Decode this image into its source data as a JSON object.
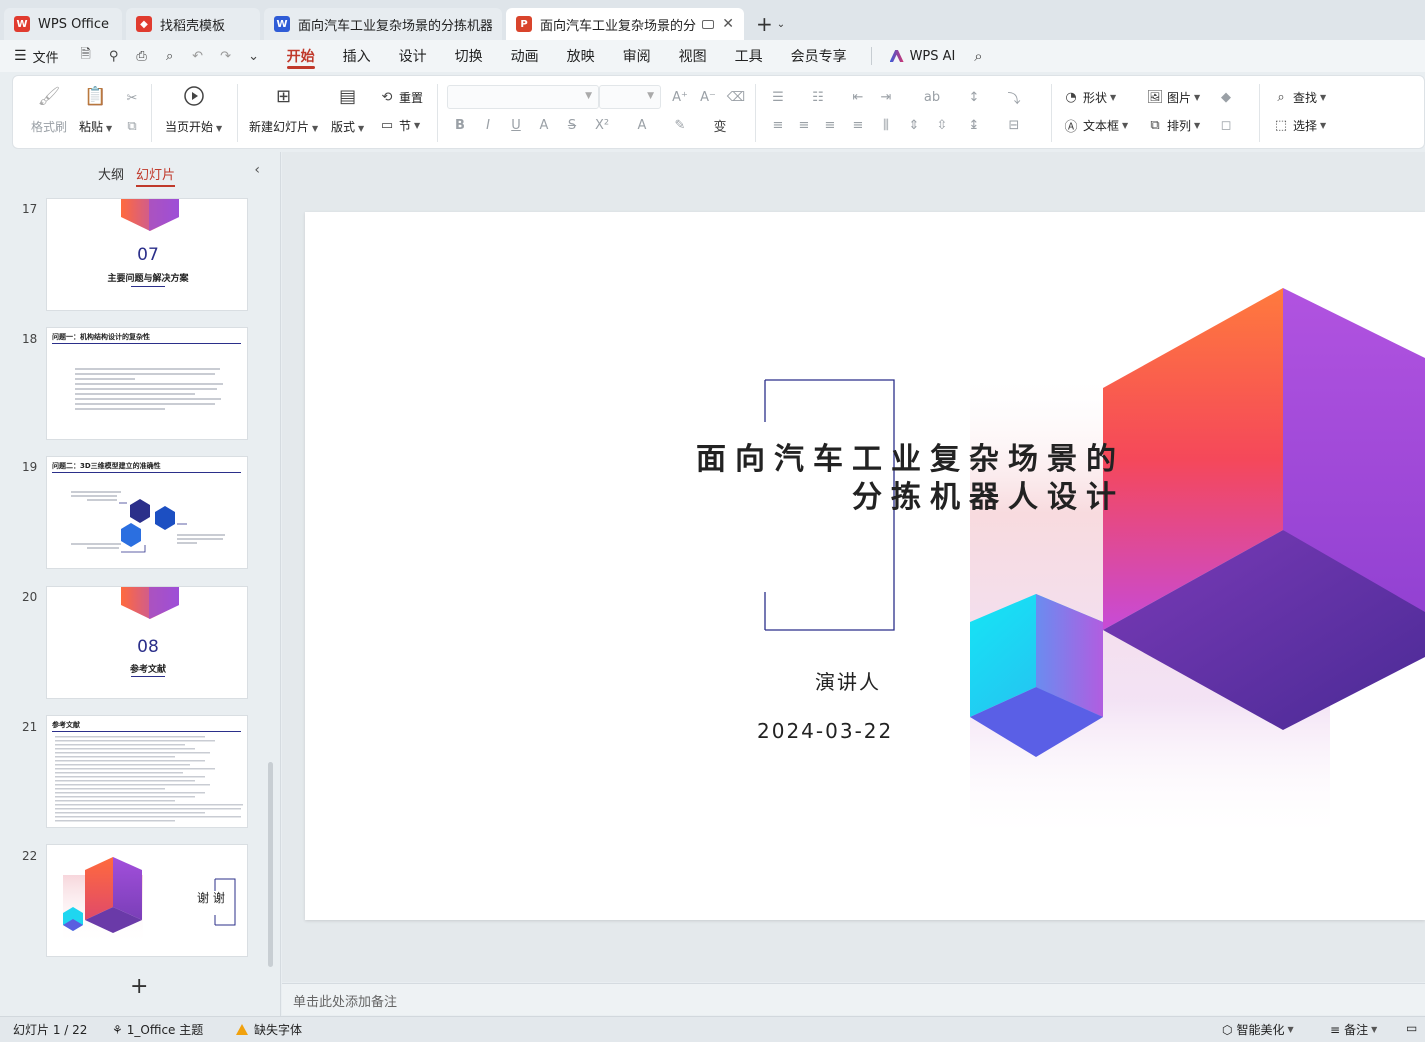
{
  "tabs": [
    {
      "label": "WPS Office",
      "icon": "wps-logo-icon",
      "color": "#e03b2f"
    },
    {
      "label": "找稻壳模板",
      "icon": "docer-icon",
      "color": "#e03b2f"
    },
    {
      "label": "面向汽车工业复杂场景的分拣机器人设",
      "icon": "word-doc-icon",
      "color": "#2f5cd6"
    },
    {
      "label": "面向汽车工业复杂场景的分拣",
      "icon": "ppt-doc-icon",
      "color": "#d9442c"
    }
  ],
  "menubar": {
    "file_label": "文件",
    "items": [
      "开始",
      "插入",
      "设计",
      "切换",
      "动画",
      "放映",
      "审阅",
      "视图",
      "工具",
      "会员专享"
    ],
    "active": "开始",
    "wps_ai": "WPS AI"
  },
  "ribbon": {
    "format_painter": "格式刷",
    "paste": "粘贴",
    "from_current": "当页开始",
    "new_slide": "新建幻灯片",
    "layout": "版式",
    "section": "节",
    "reset": "重置",
    "shape": "形状",
    "picture": "图片",
    "find": "查找",
    "textbox": "文本框",
    "arrange": "排列",
    "select": "选择"
  },
  "panel": {
    "tab_outline": "大纲",
    "tab_slides": "幻灯片",
    "thumbnails": [
      {
        "num": "17",
        "big": "07",
        "caption": "主要问题与解决方案"
      },
      {
        "num": "18",
        "heading": "问题一：机构结构设计的复杂性"
      },
      {
        "num": "19",
        "heading": "问题二：3D三维模型建立的准确性"
      },
      {
        "num": "20",
        "big": "08",
        "caption": "参考文献"
      },
      {
        "num": "21",
        "heading": "参考文献"
      },
      {
        "num": "22",
        "caption": "谢 谢"
      }
    ]
  },
  "slide": {
    "title_line1": "面向汽车工业复杂场景的",
    "title_line2": "分拣机器人设计",
    "presenter": "演讲人",
    "date": "2024-03-22"
  },
  "notes_placeholder": "单击此处添加备注",
  "status": {
    "slide_counter": "幻灯片 1 / 22",
    "theme": "1_Office 主题",
    "missing_font": "缺失字体",
    "smart_beautify": "智能美化",
    "notes": "备注"
  },
  "colors": {
    "accent": "#c0392b",
    "navy": "#2b2f8a",
    "hex_orange": "#ff6a3d",
    "hex_purple": "#9b4fd6",
    "hex_cyan": "#1fd6f0"
  }
}
